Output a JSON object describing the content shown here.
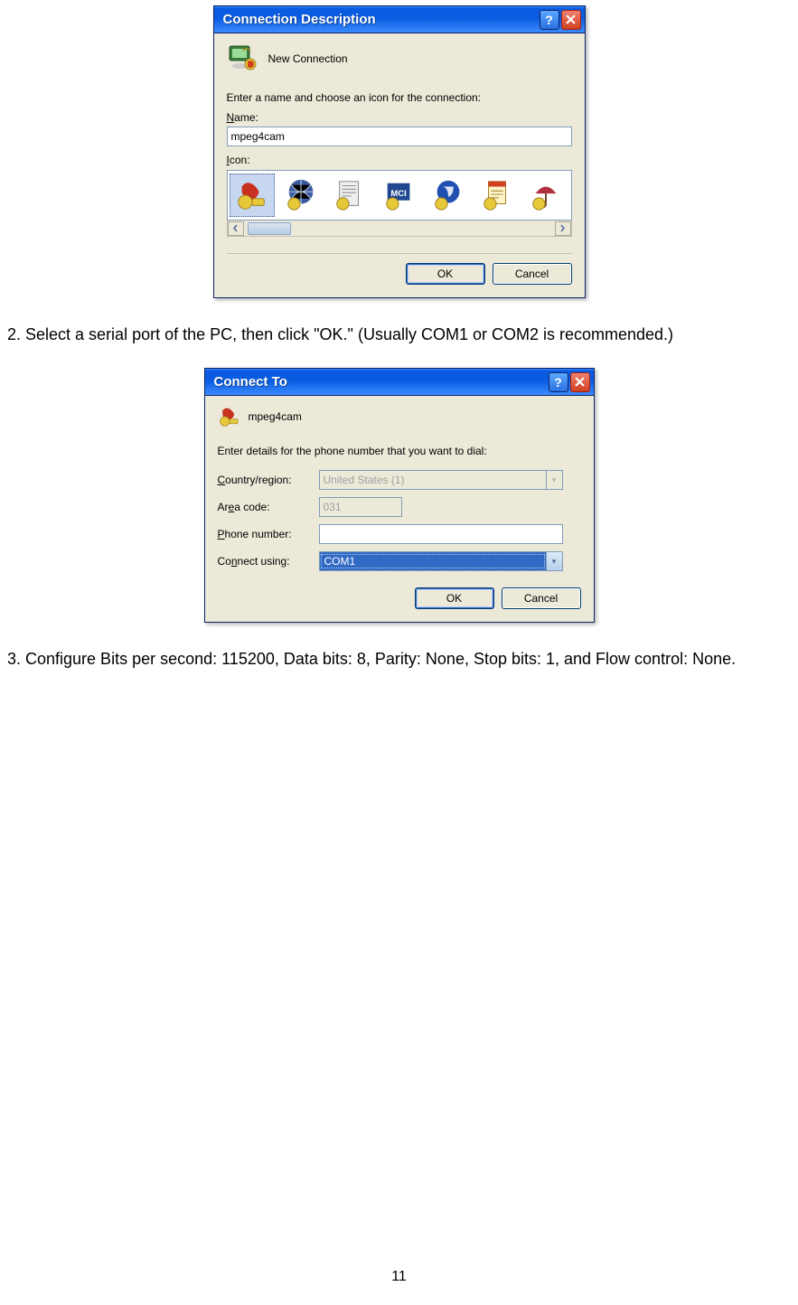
{
  "dialog1": {
    "title": "Connection Description",
    "new_connection_label": "New Connection",
    "prompt": "Enter a name and choose an icon for the connection:",
    "name_label": "Name:",
    "name_value": "mpeg4cam",
    "icon_label": "Icon:",
    "ok": "OK",
    "cancel": "Cancel",
    "icon_names": [
      "phone-icon",
      "globe-lines-icon",
      "document-icon",
      "mci-icon",
      "blue-circle-icon",
      "page-icon",
      "umbrella-icon"
    ]
  },
  "instruction2": "2. Select a serial port of the PC, then click \"OK.\" (Usually COM1 or COM2 is recommended.)",
  "dialog2": {
    "title": "Connect To",
    "conn_name": "mpeg4cam",
    "prompt": "Enter details for the phone number that you want to dial:",
    "country_label": "Country/region:",
    "country_value": "United States (1)",
    "area_label": "Area code:",
    "area_value": "031",
    "phone_label": "Phone number:",
    "phone_value": "",
    "connect_label": "Connect using:",
    "connect_value": "COM1",
    "ok": "OK",
    "cancel": "Cancel"
  },
  "instruction3": "3. Configure Bits per second: 115200, Data bits: 8, Parity: None, Stop bits: 1, and Flow control: None.",
  "page_number": "11"
}
